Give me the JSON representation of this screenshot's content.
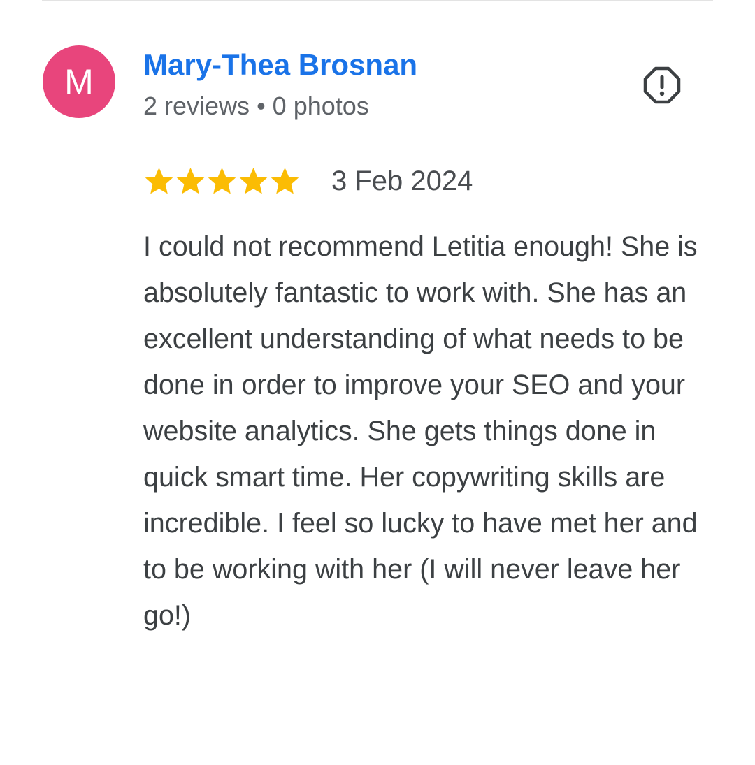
{
  "review": {
    "reviewer": {
      "avatar_initial": "M",
      "avatar_color": "#e8457c",
      "name": "Mary-Thea Brosnan",
      "name_color": "#1a73e8",
      "reviews_count": "2 reviews",
      "separator": "•",
      "photos_count": "0 photos"
    },
    "report_icon": "report-flag-octagon-exclamation-icon",
    "rating": {
      "stars": 5,
      "max_stars": 5,
      "star_color": "#fbbc04",
      "icon": "star-icon"
    },
    "date": "3 Feb 2024",
    "text": "I could not recommend Letitia enough! She is absolutely fantastic to work with. She has an excellent understanding of what needs to be done in order to improve your SEO and your website analytics. She gets things done in quick smart time. Her copywriting skills are incredible. I feel so lucky to have met her and to be working with her (I will never leave her go!)"
  }
}
